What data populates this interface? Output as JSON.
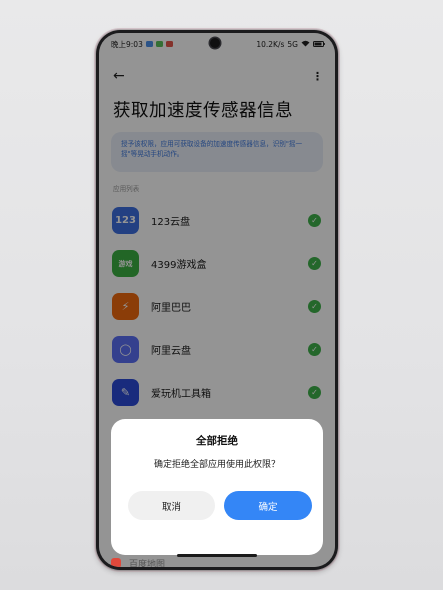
{
  "status_bar": {
    "time": "晚上9:03",
    "network_speed": "10.2K/s",
    "signal_text": "5G",
    "battery": "▮"
  },
  "toolbar": {
    "back_icon": "←",
    "more_icon": "⋮"
  },
  "page": {
    "title": "获取加速度传感器信息",
    "info_text": "授予该权限，应用可获取设备的加速度传感器信息，识别\"摇一摇\"等晃动手机动作。",
    "section_label": "应用列表"
  },
  "apps": [
    {
      "name": "123云盘",
      "icon_text": "123",
      "color": "#3d6ee0",
      "checked": true
    },
    {
      "name": "4399游戏盒",
      "icon_text": "游戏",
      "color": "#3cb043",
      "checked": true
    },
    {
      "name": "阿里巴巴",
      "icon_text": "⚡",
      "color": "#f06a0f",
      "checked": true
    },
    {
      "name": "阿里云盘",
      "icon_text": "◯",
      "color": "#5b6ef5",
      "checked": true
    },
    {
      "name": "爱玩机工具箱",
      "icon_text": "✎",
      "color": "#2c4bd8",
      "checked": true
    }
  ],
  "dialog": {
    "title": "全部拒绝",
    "message": "确定拒绝全部应用使用此权限？",
    "cancel_label": "取消",
    "ok_label": "确定"
  },
  "peek": {
    "label": "百度地图"
  },
  "colors": {
    "accent": "#3486f6",
    "check": "#3fb14a",
    "info_bg": "#e8eef9",
    "info_text": "#3f79dd"
  }
}
